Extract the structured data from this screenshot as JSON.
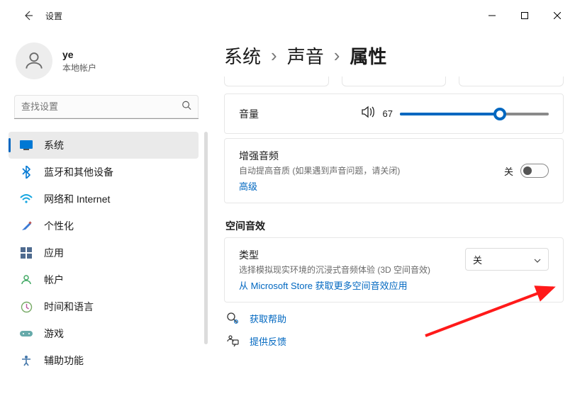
{
  "app": {
    "title": "设置"
  },
  "account": {
    "name": "ye",
    "type": "本地帐户"
  },
  "search": {
    "placeholder": "查找设置"
  },
  "sidebar": {
    "items": [
      {
        "label": "系统"
      },
      {
        "label": "蓝牙和其他设备"
      },
      {
        "label": "网络和 Internet"
      },
      {
        "label": "个性化"
      },
      {
        "label": "应用"
      },
      {
        "label": "帐户"
      },
      {
        "label": "时间和语言"
      },
      {
        "label": "游戏"
      },
      {
        "label": "辅助功能"
      }
    ]
  },
  "breadcrumb": {
    "a": "系统",
    "b": "声音",
    "c": "属性"
  },
  "volume": {
    "label": "音量",
    "value": "67",
    "percent": 67
  },
  "enhance": {
    "title": "增强音频",
    "subtitle": "自动提高音质 (如果遇到声音问题，请关闭)",
    "advanced": "高级",
    "state": "关"
  },
  "spatial": {
    "section": "空间音效",
    "type_label": "类型",
    "desc": "选择模拟现实环境的沉浸式音频体验 (3D 空间音效)",
    "store": "从 Microsoft Store 获取更多空间音效应用",
    "selected": "关"
  },
  "links": {
    "help": "获取帮助",
    "feedback": "提供反馈"
  }
}
